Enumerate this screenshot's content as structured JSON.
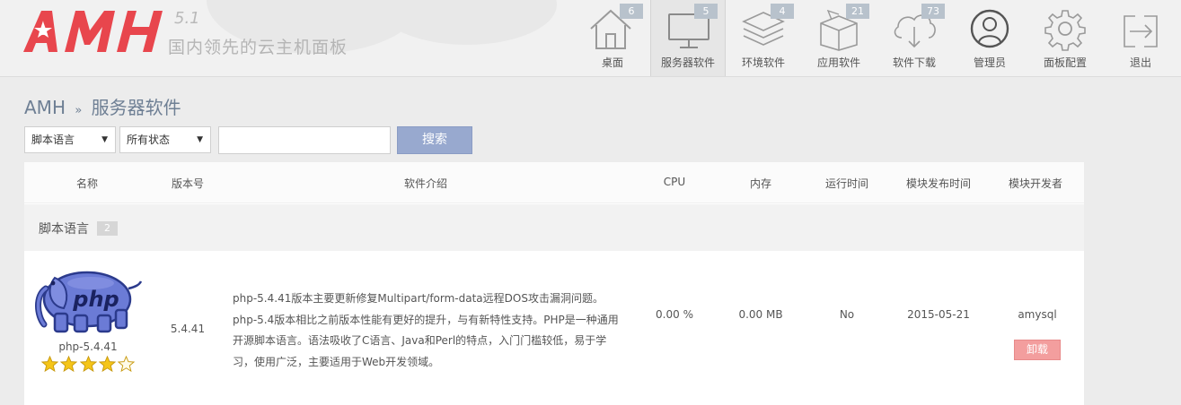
{
  "app": {
    "logo_text": "AMH",
    "version": "5.1",
    "slogan": "国内领先的云主机面板"
  },
  "nav": [
    {
      "label": "桌面",
      "badge": "6",
      "icon": "home-icon"
    },
    {
      "label": "服务器软件",
      "badge": "5",
      "icon": "monitor-icon",
      "active": true
    },
    {
      "label": "环境软件",
      "badge": "4",
      "icon": "layers-icon"
    },
    {
      "label": "应用软件",
      "badge": "21",
      "icon": "box-icon"
    },
    {
      "label": "软件下载",
      "badge": "73",
      "icon": "cloud-download-icon"
    },
    {
      "label": "管理员",
      "badge": "",
      "icon": "user-icon"
    },
    {
      "label": "面板配置",
      "badge": "",
      "icon": "gear-icon"
    },
    {
      "label": "退出",
      "badge": "",
      "icon": "logout-icon"
    }
  ],
  "breadcrumb": {
    "root": "AMH",
    "separator": "»",
    "current": "服务器软件"
  },
  "filters": {
    "type_select": "脚本语言",
    "status_select": "所有状态",
    "search_value": "",
    "search_button": "搜索"
  },
  "table": {
    "headers": [
      "名称",
      "版本号",
      "软件介绍",
      "CPU",
      "内存",
      "运行时间",
      "模块发布时间",
      "模块开发者"
    ],
    "group": {
      "label": "脚本语言",
      "count": "2"
    },
    "rows": [
      {
        "name": "php-5.4.41",
        "logo_text": "php",
        "rating": 4,
        "version": "5.4.41",
        "description": "php-5.4.41版本主要更新修复Multipart/form-data远程DOS攻击漏洞问题。php-5.4版本相比之前版本性能有更好的提升，与有新特性支持。PHP是一种通用开源脚本语言。语法吸收了C语言、Java和Perl的特点，入门门槛较低，易于学习，使用广泛，主要适用于Web开发领域。",
        "cpu": "0.00 %",
        "memory": "0.00 MB",
        "uptime": "No",
        "release_date": "2015-05-21",
        "developer": "amysql",
        "action": "卸载"
      }
    ]
  },
  "colors": {
    "logo_red": "#e8464d",
    "accent_blue": "#98a9cf",
    "uninstall_red": "#f39e9e",
    "breadcrumb": "#6e7f94",
    "star_gold": "#f5c518"
  }
}
